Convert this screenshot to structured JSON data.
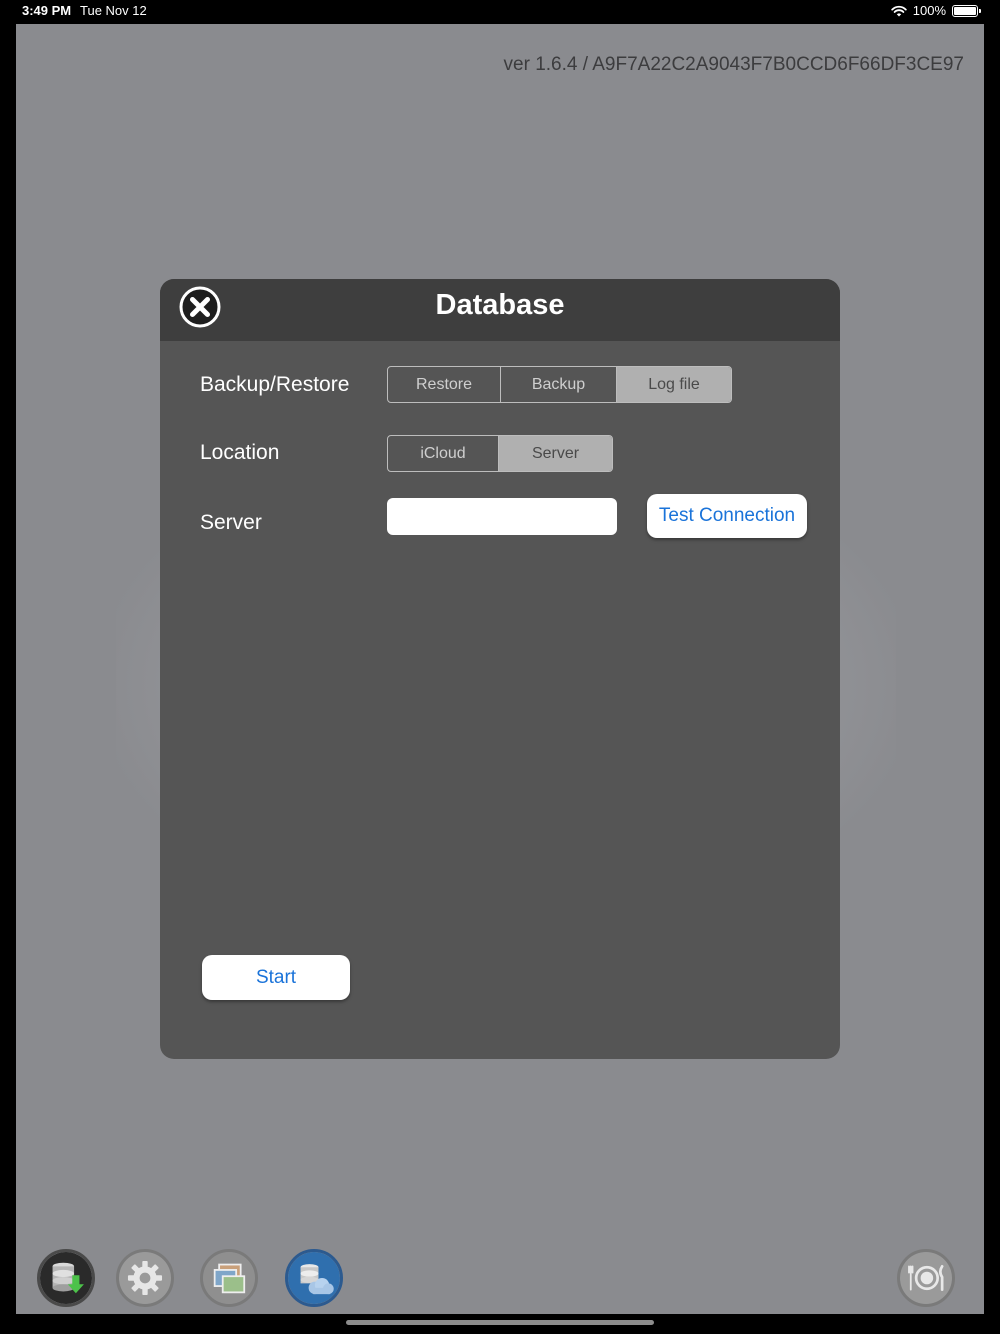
{
  "status_bar": {
    "time": "3:49 PM",
    "date": "Tue Nov 12",
    "battery": "100%"
  },
  "app": {
    "version": "ver 1.6.4 / A9F7A22C2A9043F7B0CCD6F66DF3CE97"
  },
  "dialog": {
    "title": "Database",
    "backup_restore": {
      "label": "Backup/Restore",
      "options": [
        "Restore",
        "Backup",
        "Log file"
      ],
      "selected": "Log file"
    },
    "location": {
      "label": "Location",
      "options": [
        "iCloud",
        "Server"
      ],
      "selected": "Server"
    },
    "server": {
      "label": "Server",
      "value": "",
      "placeholder": ""
    },
    "test_connection_label": "Test Connection",
    "start_label": "Start"
  },
  "toolbar": {
    "icons": [
      "database-download-icon",
      "gear-icon",
      "photos-icon",
      "database-cloud-icon",
      "plate-fork-knife-icon"
    ]
  },
  "colors": {
    "dialog_bg": "#555555",
    "dialog_header": "#3e3e3e",
    "app_bg": "#8a8b8f",
    "button_text": "#1a73d9"
  }
}
